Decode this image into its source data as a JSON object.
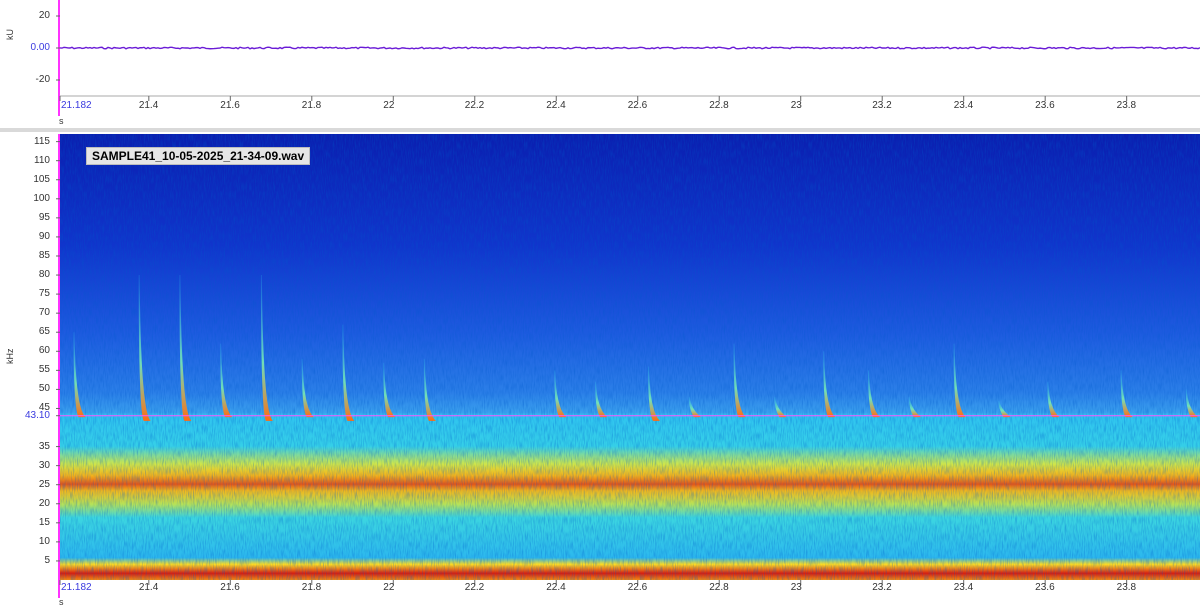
{
  "file_label": "SAMPLE41_10-05-2025_21-34-09.wav",
  "colors": {
    "cursor": "#ff55ff",
    "waveform": "#6a1bd6",
    "axis_left": "#ff33ff",
    "cursor_text": "#3a3adf"
  },
  "chart_data": [
    {
      "type": "line",
      "ylabel": "kU",
      "xlabel": "s",
      "xlim": [
        21.182,
        23.98
      ],
      "ylim": [
        -30,
        30
      ],
      "yticks": [
        "20",
        "0.00",
        "-20"
      ],
      "ytick_values": [
        20,
        0,
        -20
      ],
      "xticks": [
        "21.182",
        "21.4",
        "21.6",
        "21.8",
        "22",
        "22.2",
        "22.4",
        "22.6",
        "22.8",
        "23",
        "23.2",
        "23.4",
        "23.6",
        "23.8"
      ],
      "xtick_values": [
        21.182,
        21.4,
        21.6,
        21.8,
        22,
        22.2,
        22.4,
        22.6,
        22.8,
        23,
        23.2,
        23.4,
        23.6,
        23.8
      ],
      "series": [
        {
          "values_approx": 0
        }
      ]
    },
    {
      "type": "heatmap",
      "ylabel": "kHz",
      "xlabel": "s",
      "xlim": [
        21.182,
        23.98
      ],
      "ylim": [
        0,
        117
      ],
      "yticks": [
        "115",
        "110",
        "105",
        "100",
        "95",
        "90",
        "85",
        "80",
        "75",
        "70",
        "65",
        "60",
        "55",
        "50",
        "45",
        "43.10",
        "35",
        "30",
        "25",
        "20",
        "15",
        "10",
        "5"
      ],
      "ytick_values": [
        115,
        110,
        105,
        100,
        95,
        90,
        85,
        80,
        75,
        70,
        65,
        60,
        55,
        50,
        45,
        43.1,
        35,
        30,
        25,
        20,
        15,
        10,
        5
      ],
      "xticks": [
        "21.182",
        "21.4",
        "21.6",
        "21.8",
        "22",
        "22.2",
        "22.4",
        "22.6",
        "22.8",
        "23",
        "23.2",
        "23.4",
        "23.6",
        "23.8"
      ],
      "xtick_values": [
        21.182,
        21.4,
        21.6,
        21.8,
        22,
        22.2,
        22.4,
        22.6,
        22.8,
        23,
        23.2,
        23.4,
        23.6,
        23.8
      ],
      "cursor_khz": 43.1,
      "intensity_bands_khz": [
        {
          "center": 25.5,
          "width": 7,
          "level": 0.95
        },
        {
          "center": 2,
          "width": 3,
          "level": 1.0
        },
        {
          "center": 18,
          "width": 6,
          "level": 0.55
        },
        {
          "center": 36,
          "width": 6,
          "level": 0.45
        }
      ],
      "calls": [
        {
          "t": 21.22,
          "peak_khz": 65,
          "end_khz": 43
        },
        {
          "t": 21.38,
          "peak_khz": 80,
          "end_khz": 42
        },
        {
          "t": 21.48,
          "peak_khz": 80,
          "end_khz": 42
        },
        {
          "t": 21.58,
          "peak_khz": 62,
          "end_khz": 43
        },
        {
          "t": 21.68,
          "peak_khz": 80,
          "end_khz": 42
        },
        {
          "t": 21.78,
          "peak_khz": 58,
          "end_khz": 43
        },
        {
          "t": 21.88,
          "peak_khz": 67,
          "end_khz": 42
        },
        {
          "t": 21.98,
          "peak_khz": 57,
          "end_khz": 43
        },
        {
          "t": 22.08,
          "peak_khz": 58,
          "end_khz": 42
        },
        {
          "t": 22.4,
          "peak_khz": 55,
          "end_khz": 43
        },
        {
          "t": 22.5,
          "peak_khz": 52,
          "end_khz": 43
        },
        {
          "t": 22.63,
          "peak_khz": 56,
          "end_khz": 42
        },
        {
          "t": 22.73,
          "peak_khz": 48,
          "end_khz": 43
        },
        {
          "t": 22.84,
          "peak_khz": 62,
          "end_khz": 43
        },
        {
          "t": 22.94,
          "peak_khz": 48,
          "end_khz": 43
        },
        {
          "t": 23.06,
          "peak_khz": 60,
          "end_khz": 43
        },
        {
          "t": 23.17,
          "peak_khz": 55,
          "end_khz": 43
        },
        {
          "t": 23.27,
          "peak_khz": 48,
          "end_khz": 43
        },
        {
          "t": 23.38,
          "peak_khz": 62,
          "end_khz": 43
        },
        {
          "t": 23.49,
          "peak_khz": 47,
          "end_khz": 43
        },
        {
          "t": 23.61,
          "peak_khz": 52,
          "end_khz": 43
        },
        {
          "t": 23.79,
          "peak_khz": 55,
          "end_khz": 43
        },
        {
          "t": 23.95,
          "peak_khz": 50,
          "end_khz": 43
        }
      ]
    }
  ]
}
